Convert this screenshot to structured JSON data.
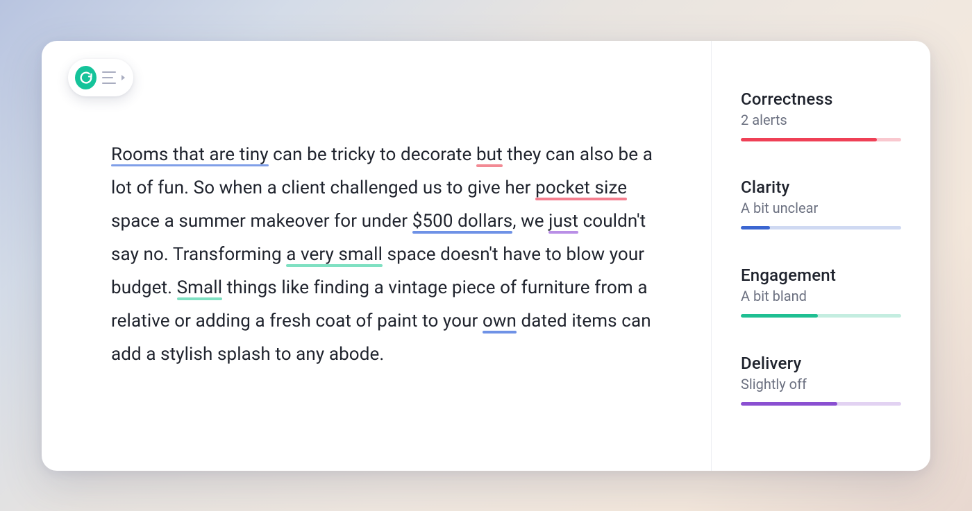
{
  "colors": {
    "red": "#ef4056",
    "red_track": "#f9c8cf",
    "blue": "#3b66d1",
    "blue_track": "#cfd9f2",
    "teal": "#1fbf92",
    "teal_track": "#c4ede0",
    "purple": "#8a4fd1",
    "purple_track": "#e2d2f2"
  },
  "text": {
    "segments": [
      {
        "t": "Rooms that are tiny",
        "u": "blue-thin"
      },
      {
        "t": " can be tricky to decorate "
      },
      {
        "t": "but",
        "u": "pink"
      },
      {
        "t": " they can also be a lot of fun.  So when a client challenged us to give her "
      },
      {
        "t": "pocket size",
        "u": "red"
      },
      {
        "t": " space a summer makeover for under "
      },
      {
        "t": "$500 dollars",
        "u": "blue"
      },
      {
        "t": ", we "
      },
      {
        "t": "just",
        "u": "purple"
      },
      {
        "t": " couldn't say no. Transforming "
      },
      {
        "t": "a very small",
        "u": "teal"
      },
      {
        "t": " space doesn't have to blow your budget. "
      },
      {
        "t": "Small",
        "u": "teal"
      },
      {
        "t": " things like finding a vintage piece of furniture from a relative or adding a fresh coat of paint to your "
      },
      {
        "t": "own",
        "u": "blue"
      },
      {
        "t": " dated items can add a stylish splash to any abode."
      }
    ]
  },
  "sidebar": {
    "metrics": [
      {
        "title": "Correctness",
        "sub": "2 alerts",
        "color": "red",
        "fill": 0.85
      },
      {
        "title": "Clarity",
        "sub": "A bit unclear",
        "color": "blue",
        "fill": 0.18
      },
      {
        "title": "Engagement",
        "sub": "A bit bland",
        "color": "teal",
        "fill": 0.48
      },
      {
        "title": "Delivery",
        "sub": "Slightly off",
        "color": "purple",
        "fill": 0.6
      }
    ]
  }
}
